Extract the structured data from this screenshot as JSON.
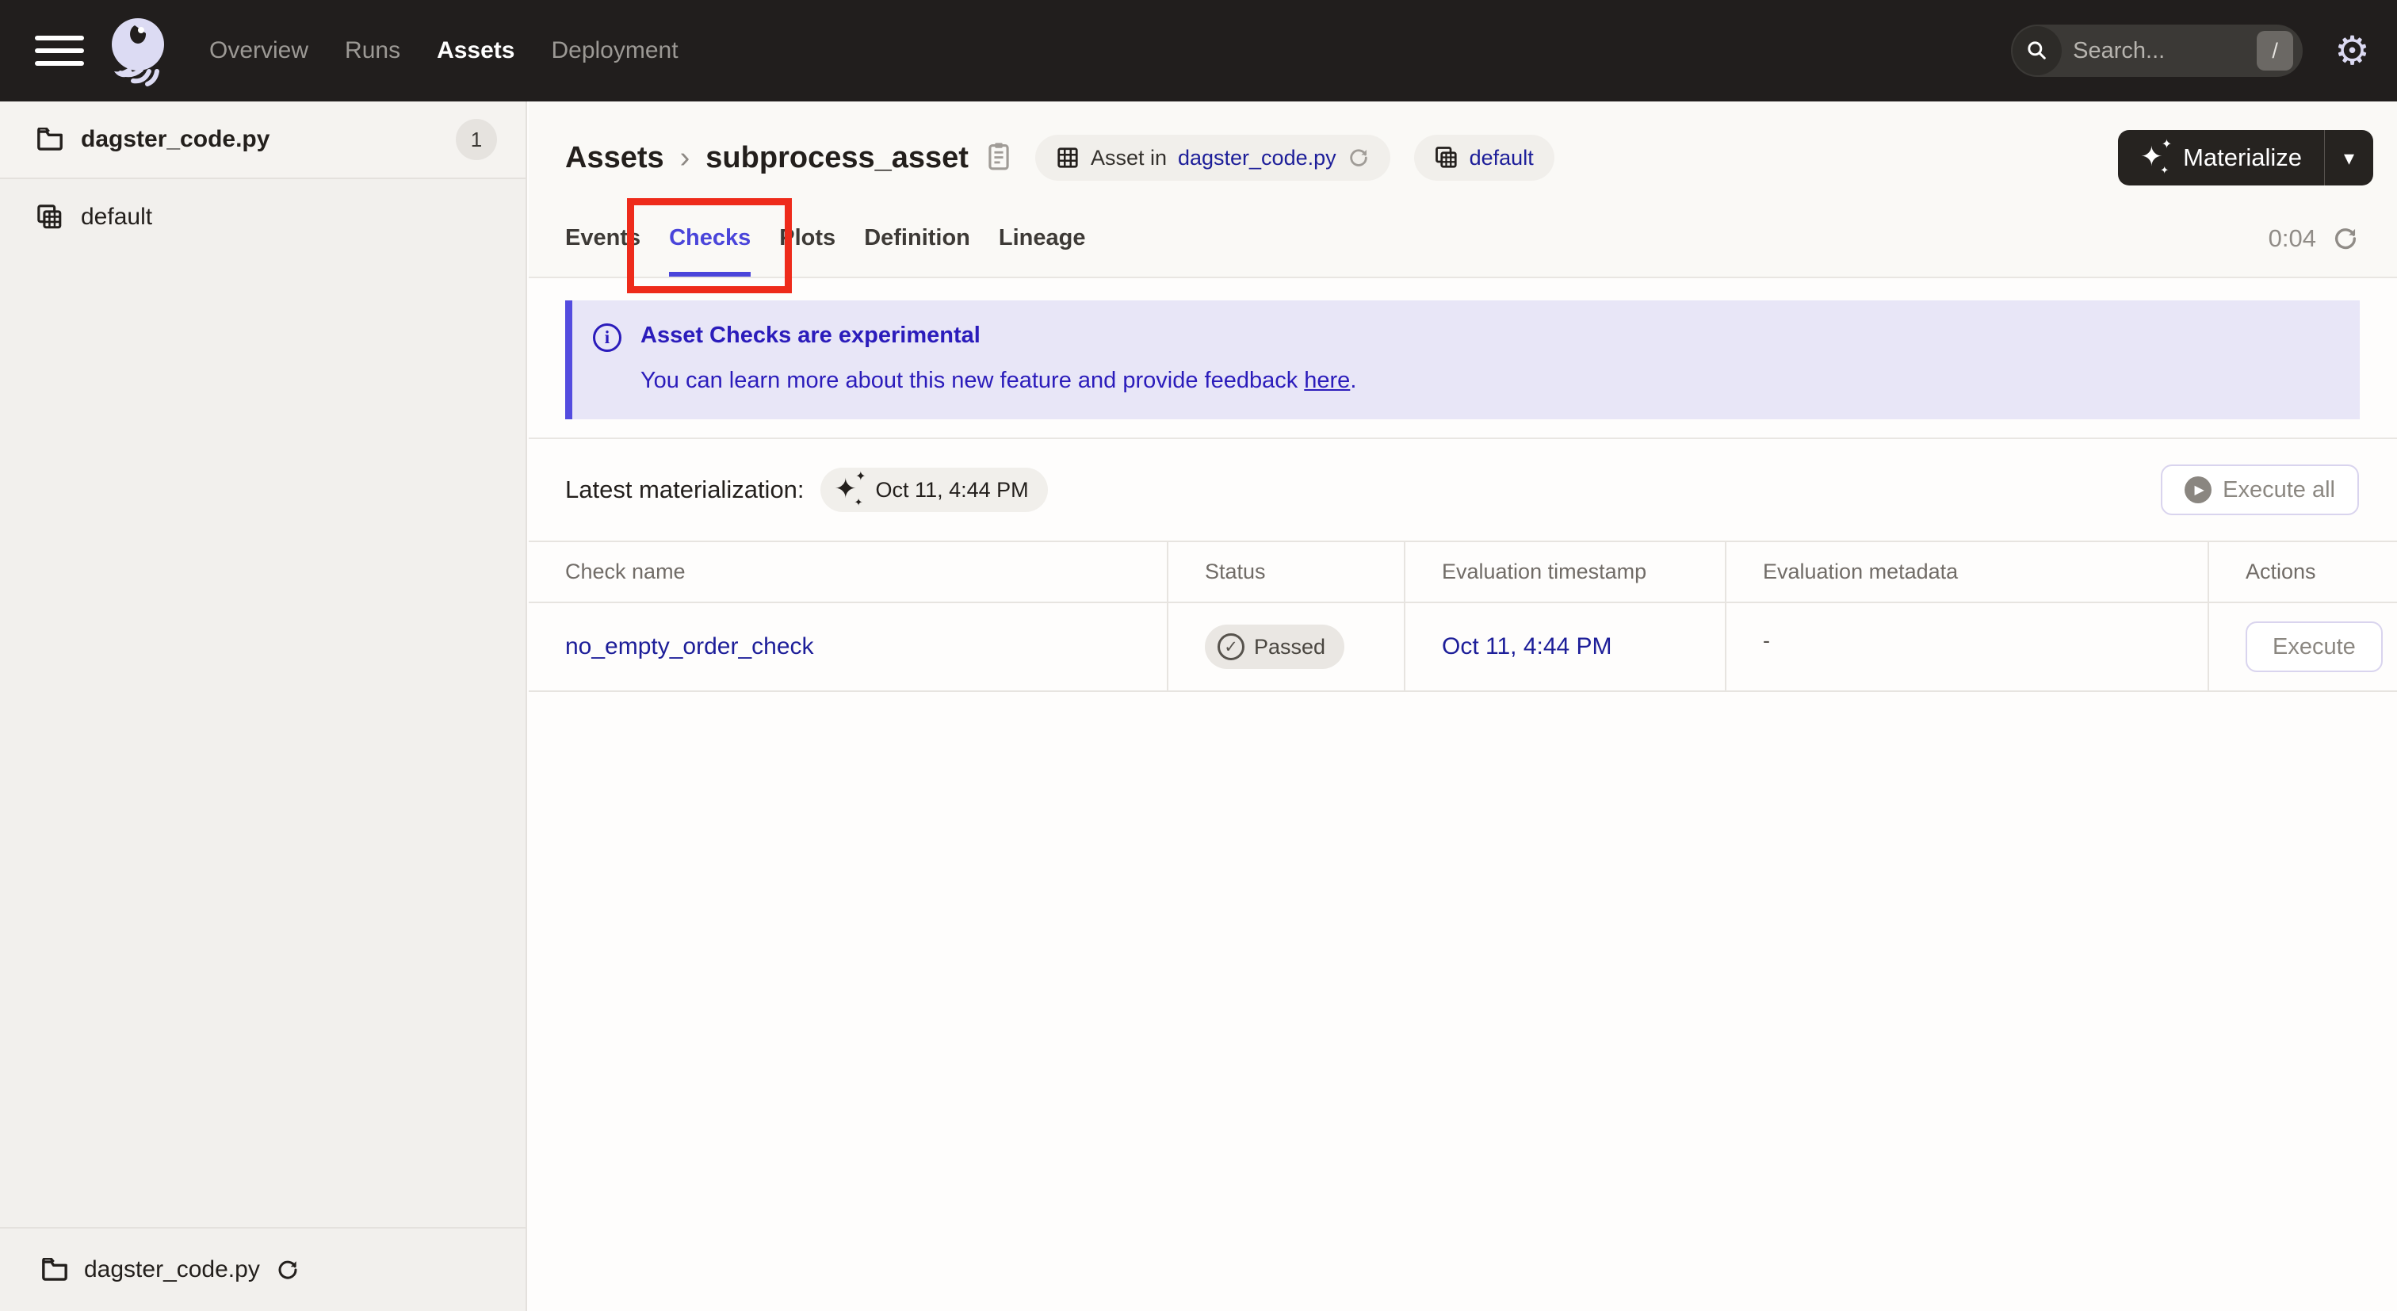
{
  "topbar": {
    "nav": [
      {
        "label": "Overview",
        "active": false
      },
      {
        "label": "Runs",
        "active": false
      },
      {
        "label": "Assets",
        "active": true
      },
      {
        "label": "Deployment",
        "active": false
      }
    ],
    "search_placeholder": "Search...",
    "search_shortcut": "/"
  },
  "sidebar": {
    "groups": [
      {
        "label": "dagster_code.py",
        "count": "1"
      },
      {
        "label": "default"
      }
    ],
    "footer": {
      "label": "dagster_code.py"
    }
  },
  "header": {
    "breadcrumb_root": "Assets",
    "breadcrumb_current": "subprocess_asset",
    "asset_in_prefix": "Asset in",
    "asset_in_link": "dagster_code.py",
    "group_badge": "default",
    "materialize_label": "Materialize"
  },
  "tabs": {
    "items": [
      {
        "label": "Events"
      },
      {
        "label": "Checks"
      },
      {
        "label": "Plots"
      },
      {
        "label": "Definition"
      },
      {
        "label": "Lineage"
      }
    ],
    "active": "Checks",
    "timer": "0:04"
  },
  "banner": {
    "title": "Asset Checks are experimental",
    "body_prefix": "You can learn more about this new feature and provide feedback ",
    "link_text": "here",
    "body_suffix": "."
  },
  "latest": {
    "label": "Latest materialization:",
    "timestamp": "Oct 11, 4:44 PM",
    "execute_all_label": "Execute all"
  },
  "table": {
    "columns": [
      "Check name",
      "Status",
      "Evaluation timestamp",
      "Evaluation metadata",
      "Actions"
    ],
    "rows": [
      {
        "name": "no_empty_order_check",
        "status": "Passed",
        "timestamp": "Oct 11, 4:44 PM",
        "metadata": "-",
        "action_label": "Execute"
      }
    ]
  },
  "icons": {
    "sparkle": "✦",
    "caret_down": "▾",
    "chevron_right": "›",
    "check": "✓",
    "play": "▶",
    "gear": "⚙"
  },
  "colors": {
    "topbar_bg": "#211E1D",
    "accent_blurple": "#4A45DA",
    "banner_bg": "#E8E6F7",
    "banner_text": "#2B1CBB",
    "link_navy": "#1D1E99",
    "annotation_red": "#EE2B1B",
    "sidebar_bg": "#F2F0ED",
    "header_strip_bg": "#FAF9F6"
  }
}
